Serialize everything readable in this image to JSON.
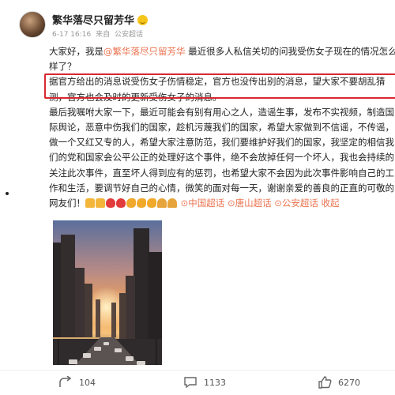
{
  "header": {
    "username": "繁华落尽只留芳华",
    "timestamp": "6-17 16:16",
    "source": "来自",
    "visibility": "公安超话"
  },
  "post": {
    "intro_before": "大家好，我是",
    "mention": "@繁华落尽只留芳华",
    "intro_after": " 最近很多人私信关切的问我受伤女子现在的情况怎么样了？",
    "highlight": "据官方给出的消息说受伤女子伤情稳定，官方也没传出别的消息，望大家不要胡乱猜测，官方也会及时的更新受伤女子的消息。",
    "body": "最后我嘱咐大家一下，最近可能会有别有用心之人，造谣生事，发布不实视频，制造国际舆论，恶意中伤我们的国家，趁机污蔑我们的国家，希望大家做到不信谣，不传谣，做一个又红又专的人，希望大家注意防范，我们要维护好我们的国家，我坚定的相信我们的党和国家会公平公正的处理好这个事件，绝不会放掉任何一个坏人，我也会持续的关注此次事件，直至坏人得到应有的惩罚，也希望大家不会因为此次事件影响自己的工作和生活，要调节好自己的心情，微笑的面对每一天，谢谢亲爱的善良的正直的可敬的网友们！",
    "topics": [
      "中国超话",
      "唐山超话",
      "公安超话"
    ],
    "collect": "收起"
  },
  "footer": {
    "share_count": "104",
    "comment_count": "1133",
    "like_count": "6270"
  },
  "colors": {
    "accent": "#eb7350",
    "highlight_border": "#d8282f"
  },
  "icons": [
    "share-icon",
    "comment-icon",
    "like-icon",
    "topic-icon"
  ]
}
